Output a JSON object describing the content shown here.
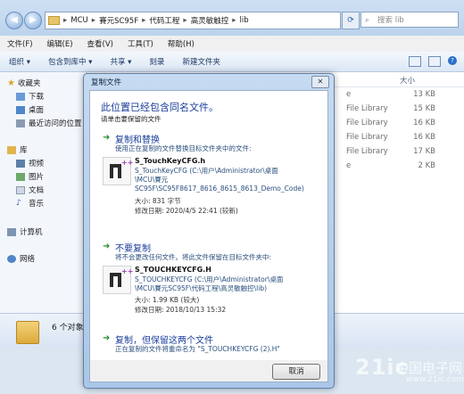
{
  "address": {
    "crumbs": [
      "MCU",
      "賽元SC95F",
      "代码工程",
      "高灵敏触控",
      "lib"
    ],
    "search_placeholder": "搜索 lib"
  },
  "menu": [
    "文件(F)",
    "编辑(E)",
    "查看(V)",
    "工具(T)",
    "帮助(H)"
  ],
  "toolbar": {
    "organize": "组织 ▾",
    "include_in_library": "包含到库中 ▾",
    "share": "共享 ▾",
    "burn": "刻录",
    "new_folder": "新建文件夹"
  },
  "nav": {
    "favorites": "收藏夹",
    "downloads": "下载",
    "desktop": "桌面",
    "recent": "最近访问的位置",
    "libraries": "库",
    "videos": "视频",
    "pictures": "图片",
    "documents": "文档",
    "music": "音乐",
    "computer": "计算机",
    "network": "网络"
  },
  "filelist": {
    "size_header": "大小",
    "rows": [
      {
        "type": "e",
        "size": "13 KB"
      },
      {
        "type": "File Library",
        "size": "15 KB"
      },
      {
        "type": "File Library",
        "size": "16 KB"
      },
      {
        "type": "File Library",
        "size": "16 KB"
      },
      {
        "type": "File Library",
        "size": "17 KB"
      },
      {
        "type": "e",
        "size": "2 KB"
      }
    ]
  },
  "status": {
    "count": "6 个对象"
  },
  "watermark": {
    "big": "21ic",
    "cn": "中国电子网",
    "url": "www.21ic.com"
  },
  "dialog": {
    "title": "复制文件",
    "close": "✕",
    "heading": "此位置已经包含同名文件。",
    "subheading": "请单击要保留的文件",
    "option1": {
      "title": "复制和替换",
      "desc": "使用正在复制的文件替换目标文件夹中的文件:",
      "file_name": "S_TouchKeyCFG.h",
      "file_path": "S_TouchKeyCFG (C:\\用户\\Administrator\\桌面\\MCU\\賽元SC95F\\SC95F8617_8616_8615_8613_Demo_Code)",
      "size": "大小: 831 字节",
      "modified": "修改日期: 2020/4/5 22:41 (较新)"
    },
    "option2": {
      "title": "不要复制",
      "desc": "将不会更改任何文件。将此文件保留在目标文件夹中:",
      "file_name": "S_TOUCHKEYCFG.H",
      "file_path": "S_TOUCHKEYCFG (C:\\用户\\Administrator\\桌面\\MCU\\賽元SC95F\\代码工程\\高灵敏触控\\lib)",
      "size": "大小: 1.99 KB (较大)",
      "modified": "修改日期: 2018/10/13 15:32"
    },
    "option3": {
      "title": "复制，但保留这两个文件",
      "desc": "正在复制的文件将重命名为 \"S_TOUCHKEYCFG (2).H\""
    },
    "cancel": "取消"
  }
}
